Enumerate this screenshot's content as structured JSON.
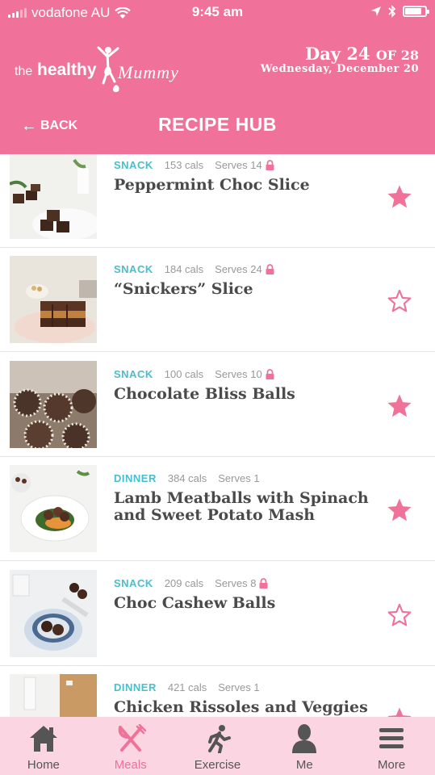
{
  "status": {
    "carrier": "vodafone AU",
    "time": "9:45 am"
  },
  "header": {
    "logo": {
      "the": "the",
      "healthy": "healthy",
      "mummy": "Mummy"
    },
    "day_label": "Day 24",
    "day_of": "OF 28",
    "date": "Wednesday, December 20",
    "back_label": "BACK",
    "title": "RECIPE HUB"
  },
  "recipes": [
    {
      "category": "SNACK",
      "cals": "153 cals",
      "serves": "Serves 14",
      "locked": true,
      "title": "Peppermint Choc Slice",
      "favorite": true,
      "thumb": "chocolate slice squares on plate"
    },
    {
      "category": "SNACK",
      "cals": "184 cals",
      "serves": "Serves 24",
      "locked": true,
      "title": "“Snickers” Slice",
      "favorite": false,
      "thumb": "stacked caramel slice"
    },
    {
      "category": "SNACK",
      "cals": "100 cals",
      "serves": "Serves 10",
      "locked": true,
      "title": "Chocolate Bliss Balls",
      "favorite": true,
      "thumb": "coconut bliss balls"
    },
    {
      "category": "DINNER",
      "cals": "384 cals",
      "serves": "Serves 1",
      "locked": false,
      "title": "Lamb Meatballs with Spinach and Sweet Potato Mash",
      "favorite": true,
      "thumb": "meatballs on white plate"
    },
    {
      "category": "SNACK",
      "cals": "209 cals",
      "serves": "Serves 8",
      "locked": true,
      "title": "Choc Cashew Balls",
      "favorite": false,
      "thumb": "chocolate balls in blue bowl"
    },
    {
      "category": "DINNER",
      "cals": "421 cals",
      "serves": "Serves 1",
      "locked": false,
      "title": "Chicken Rissoles and Veggies",
      "favorite": true,
      "thumb": "rissoles with board"
    }
  ],
  "tabs": [
    {
      "label": "Home",
      "icon": "home-icon",
      "active": false
    },
    {
      "label": "Meals",
      "icon": "fork-knife-icon",
      "active": true
    },
    {
      "label": "Exercise",
      "icon": "runner-icon",
      "active": false
    },
    {
      "label": "Me",
      "icon": "person-icon",
      "active": false
    },
    {
      "label": "More",
      "icon": "menu-icon",
      "active": false
    }
  ],
  "colors": {
    "brand_pink": "#f07199",
    "snack_teal": "#47bfcf",
    "tab_bg": "#fbd6e2"
  }
}
